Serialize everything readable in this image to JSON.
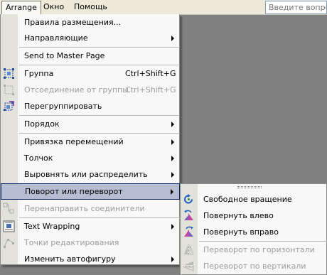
{
  "menubar": {
    "items": [
      "Arrange",
      "Окно",
      "Помощь"
    ],
    "help_placeholder": "Введите вопрос"
  },
  "arrange_menu": {
    "items": [
      {
        "label": "Правила размещения...",
        "shortcut": "",
        "submenu": false,
        "disabled": false,
        "icon": "none"
      },
      {
        "label": "Направляющие",
        "shortcut": "",
        "submenu": true,
        "disabled": false,
        "icon": "none"
      },
      {
        "label": "Send to Master Page",
        "shortcut": "",
        "submenu": false,
        "disabled": false,
        "icon": "none"
      },
      {
        "label": "Группа",
        "shortcut": "Ctrl+Shift+G",
        "submenu": false,
        "disabled": false,
        "icon": "group-icon"
      },
      {
        "label": "Отсоединение от группы",
        "shortcut": "Ctrl+Shift+G",
        "submenu": false,
        "disabled": true,
        "icon": "ungroup-icon"
      },
      {
        "label": "Перегруппировать",
        "shortcut": "",
        "submenu": false,
        "disabled": false,
        "icon": "regroup-icon"
      },
      {
        "label": "Порядок",
        "shortcut": "",
        "submenu": true,
        "disabled": false,
        "icon": "none"
      },
      {
        "label": "Привязка перемещений",
        "shortcut": "",
        "submenu": true,
        "disabled": false,
        "icon": "none"
      },
      {
        "label": "Толчок",
        "shortcut": "",
        "submenu": true,
        "disabled": false,
        "icon": "none"
      },
      {
        "label": "Выровнять или распределить",
        "shortcut": "",
        "submenu": true,
        "disabled": false,
        "icon": "none"
      },
      {
        "label": "Поворот или переворот",
        "shortcut": "",
        "submenu": true,
        "disabled": false,
        "icon": "none",
        "highlighted": true
      },
      {
        "label": "Перенаправить соединители",
        "shortcut": "",
        "submenu": false,
        "disabled": true,
        "icon": "reroute-connectors-icon"
      },
      {
        "label": "Text Wrapping",
        "shortcut": "",
        "submenu": true,
        "disabled": false,
        "icon": "text-wrap-icon"
      },
      {
        "label": "Точки редактирования",
        "shortcut": "",
        "submenu": false,
        "disabled": true,
        "icon": "edit-points-icon"
      },
      {
        "label": "Изменить автофигуру",
        "shortcut": "",
        "submenu": true,
        "disabled": false,
        "icon": "none"
      }
    ]
  },
  "rotate_submenu": {
    "items": [
      {
        "label": "Свободное вращение",
        "disabled": false,
        "icon": "free-rotate-icon"
      },
      {
        "label": "Повернуть влево",
        "disabled": false,
        "icon": "rotate-left-icon"
      },
      {
        "label": "Повернуть вправо",
        "disabled": false,
        "icon": "rotate-right-icon"
      },
      {
        "label": "Переворот по горизонтали",
        "disabled": true,
        "icon": "flip-horizontal-icon"
      },
      {
        "label": "Переворот по вертикали",
        "disabled": true,
        "icon": "flip-vertical-icon"
      }
    ]
  },
  "colors": {
    "menu_bg": "#F8F8F8",
    "icon_strip": "#E3E2DA",
    "highlight_bg": "#B6BDD2",
    "highlight_border": "#0A246A",
    "disabled_text": "#9C9C9C",
    "workspace": "#808080"
  }
}
